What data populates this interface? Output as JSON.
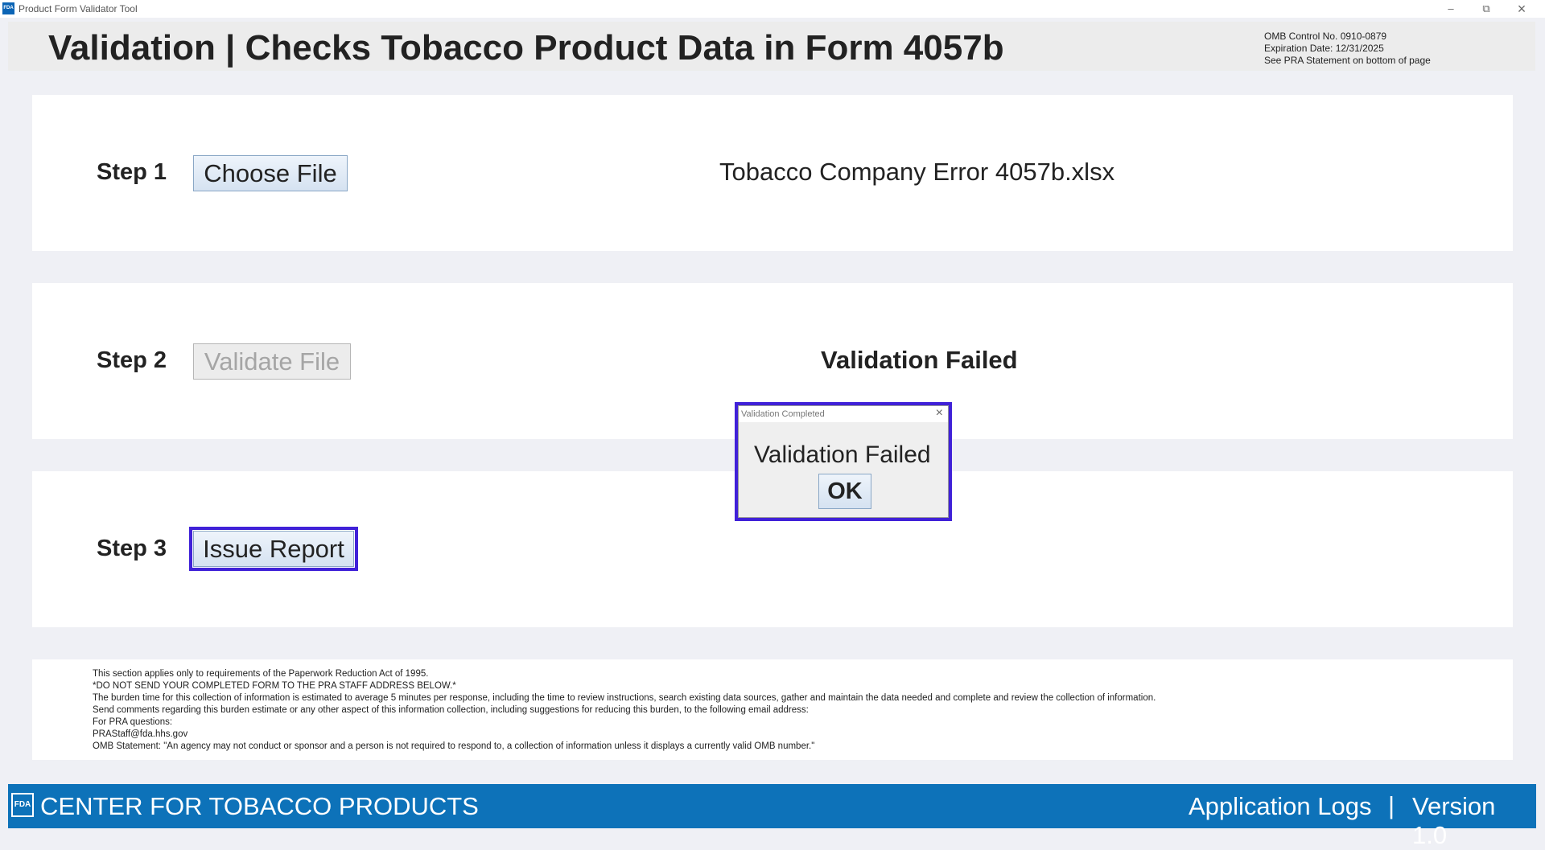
{
  "window": {
    "title": "Product Form Validator Tool",
    "icon_text": "FDA",
    "controls": {
      "minimize": "–",
      "maximize": "⧉",
      "close": "×"
    }
  },
  "header": {
    "title": "Validation | Checks Tobacco Product Data in Form 4057b",
    "omb_lines": [
      "OMB Control No. 0910-0879",
      "Expiration Date: 12/31/2025",
      "See PRA Statement on bottom of page"
    ]
  },
  "steps": [
    {
      "label": "Step 1",
      "button": "Choose File",
      "status": "Tobacco Company Error 4057b.xlsx"
    },
    {
      "label": "Step 2",
      "button": "Validate File",
      "status": "Validation Failed",
      "button_disabled": true
    },
    {
      "label": "Step 3",
      "button": "Issue Report"
    }
  ],
  "pra_statement": [
    "This section applies only to requirements of the Paperwork Reduction Act of 1995.",
    "*DO NOT SEND YOUR COMPLETED FORM TO THE PRA STAFF ADDRESS BELOW.*",
    "The burden time for this collection of information is estimated to average 5 minutes per response, including the time to review instructions, search existing data sources, gather and maintain the data needed and complete and review the collection of information.",
    "Send comments regarding this burden estimate or any other aspect of this information collection, including suggestions for reducing this burden, to the following email address:",
    "For PRA questions:",
    "PRAStaff@fda.hhs.gov",
    "OMB Statement: \"An agency may not conduct or sponsor and a person is not required to respond to, a collection of information unless it displays a currently valid OMB number.\""
  ],
  "footer": {
    "logo_text": "FDA",
    "center_name": "CENTER FOR TOBACCO PRODUCTS",
    "app_logs": "Application Logs",
    "separator": "|",
    "version": "Version 1.0"
  },
  "dialog": {
    "title": "Validation Completed",
    "close": "×",
    "message": "Validation Failed",
    "ok": "OK"
  },
  "colors": {
    "background": "#eff0f5",
    "footer_bar": "#0d72b9",
    "highlight_outline": "#4021d8"
  }
}
